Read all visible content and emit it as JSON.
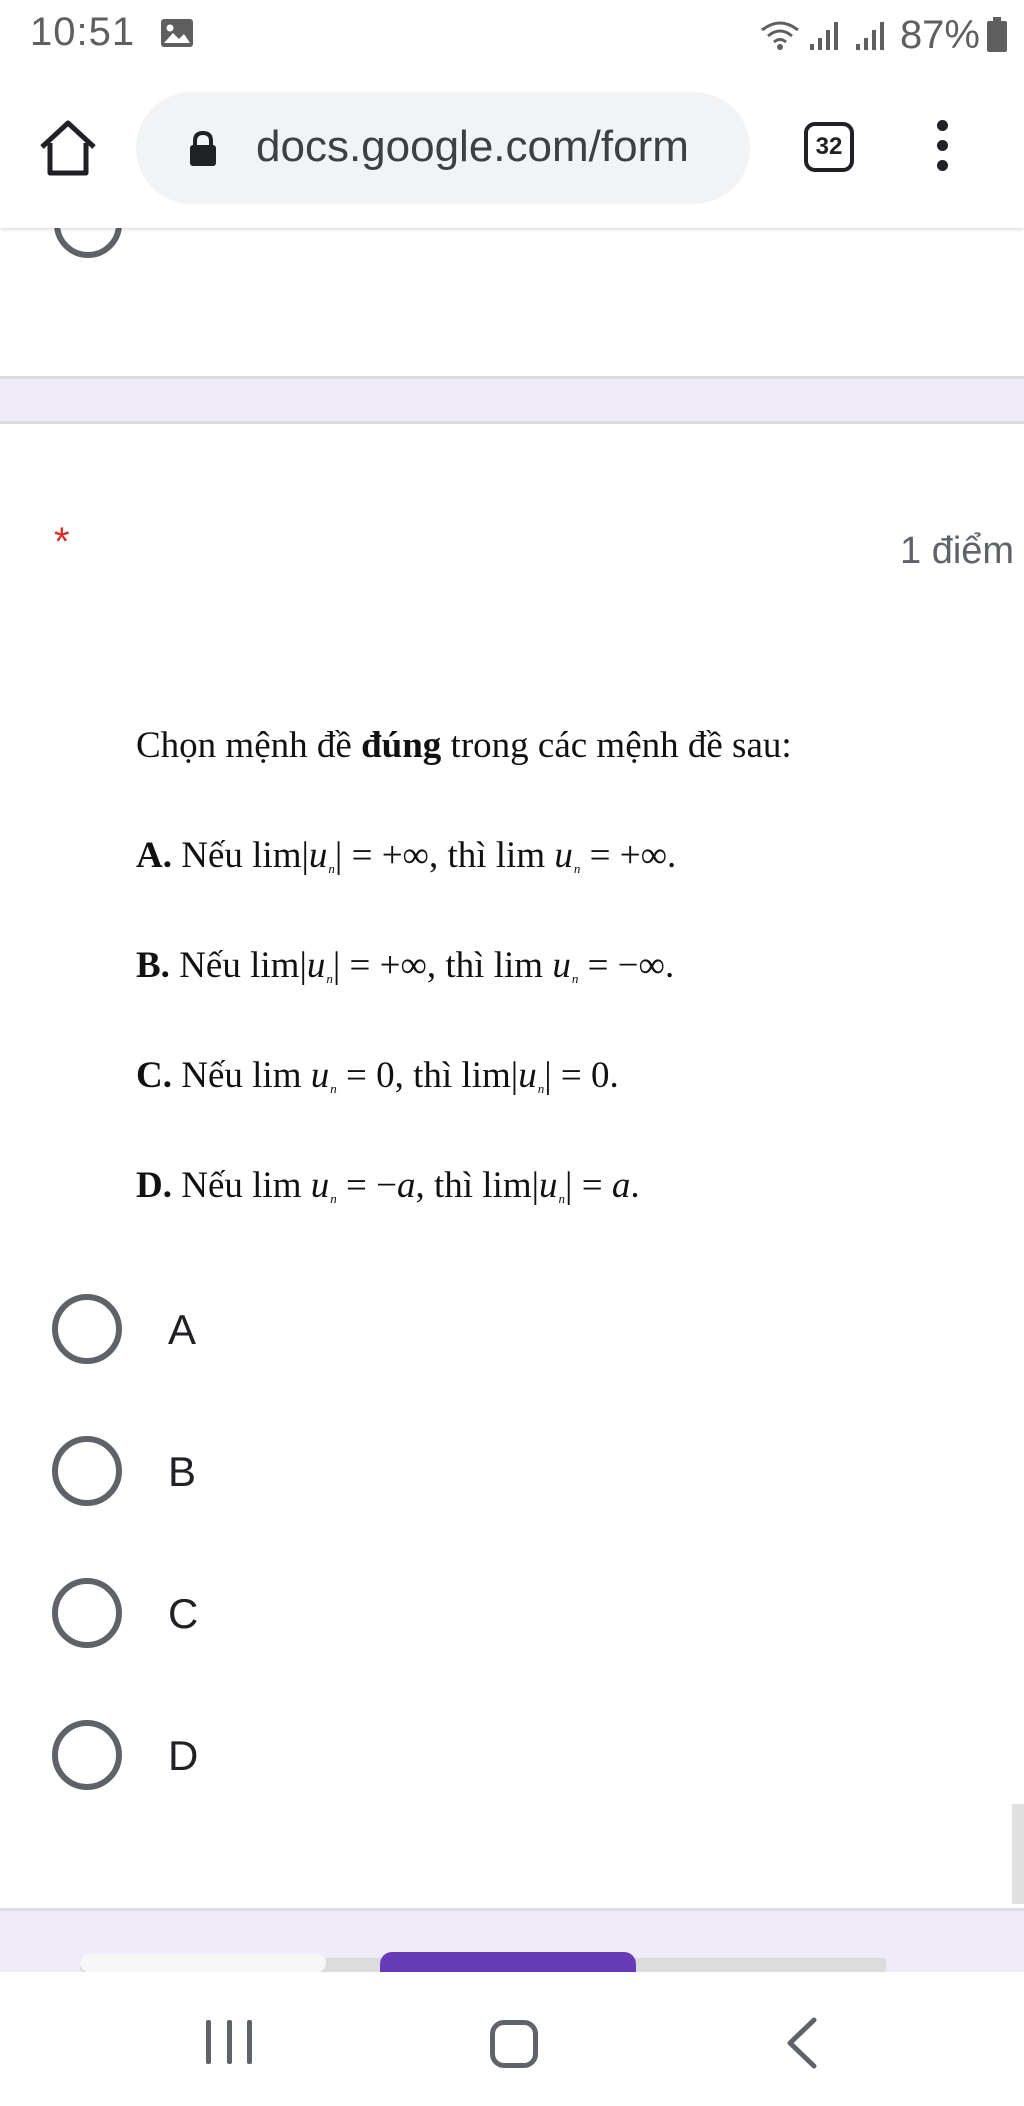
{
  "status_bar": {
    "time": "10:51",
    "battery": "87%",
    "icons": [
      "image-icon",
      "wifi-icon",
      "signal-icon",
      "signal-icon",
      "battery-icon"
    ]
  },
  "browser": {
    "url": "docs.google.com/form",
    "tab_count": "32",
    "icons": [
      "home-icon",
      "lock-icon",
      "tabs-icon",
      "more-vert-icon"
    ]
  },
  "question": {
    "required_mark": "*",
    "points": "1 điểm",
    "prompt_start": "Chọn mệnh đề ",
    "prompt_bold": "đúng",
    "prompt_end": " trong các mệnh đề sau:",
    "statements": [
      {
        "letter": "A.",
        "if": "Nếu",
        "lim": "lim",
        "var": "u",
        "sub": "n",
        "eq1": "= +∞",
        "then": ", thì",
        "eq2": "= +∞",
        "end": "."
      },
      {
        "letter": "B.",
        "if": "Nếu",
        "lim": "lim",
        "var": "u",
        "sub": "n",
        "eq1": "= +∞",
        "then": ", thì",
        "eq2": "= −∞",
        "end": "."
      },
      {
        "letter": "C.",
        "if": "Nếu",
        "lim": "lim",
        "var": "u",
        "sub": "n",
        "eq1": "= 0",
        "then": ", thì",
        "eq2": "= 0",
        "end": "."
      },
      {
        "letter": "D.",
        "if": "Nếu",
        "lim": "lim",
        "var": "u",
        "sub": "n",
        "eq1": "= −",
        "a1": "a",
        "then": ", thì",
        "eq2": "= ",
        "a2": "a",
        "end": "."
      }
    ],
    "choices": [
      "A",
      "B",
      "C",
      "D"
    ]
  },
  "accent_color": "#673ab7",
  "required_color": "#d93025",
  "form_background": "#f0ebf8"
}
